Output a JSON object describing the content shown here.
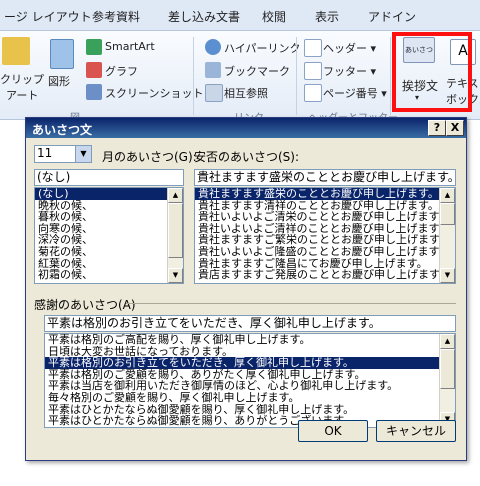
{
  "ribbon": {
    "tabs": [
      "ージ レイアウト",
      "参考資料",
      "差し込み文書",
      "校閲",
      "表示",
      "アドイン"
    ],
    "items": {
      "clip1": "クリップ",
      "clip2": "アート",
      "shape": "図形",
      "smartart": "SmartArt",
      "graph": "グラフ",
      "screenshot": "スクリーンショット ▾",
      "hyperlink": "ハイパーリンク",
      "bookmark": "ブックマーク",
      "crossref": "相互参照",
      "header": "ヘッダー ▾",
      "footer": "フッター ▾",
      "pagenum": "ページ番号 ▾",
      "greeting": "挨拶文",
      "greeting_icon_text": "あいさつ",
      "textbox1": "テキスト",
      "textbox2": "ボックス"
    },
    "groups": [
      "図",
      "リンク",
      "ヘッダーとフッター"
    ]
  },
  "dialog": {
    "title": "あいさつ文",
    "help": "?",
    "close": "X",
    "month_value": "11",
    "month_label": "月のあいさつ(G):",
    "anpi_label": "安否のあいさつ(S):",
    "month_field": "(なし)",
    "anpi_field": "貴社ますます盛栄のこととお慶び申し上げます。",
    "month_items": [
      "(なし)",
      "晩秋の候、",
      "暮秋の候、",
      "向寒の候、",
      "深冷の候、",
      "菊花の候、",
      "紅葉の候、",
      "初霜の候、"
    ],
    "month_selected": 0,
    "anpi_items": [
      "貴社ますます盛栄のこととお慶び申し上げます。",
      "貴社ますます清祥のこととお慶び申し上げます。",
      "貴社いよいよご清栄のこととお慶び申し上げます。",
      "貴社いよいよご清祥のこととお慶び申し上げます。",
      "貴社ますますご繁栄のこととお慶び申し上げます。",
      "貴社いよいよご隆盛のこととお慶び申し上げます。",
      "貴社ますますご隆昌にてお慶び申し上げます。",
      "貴店ますますご発展のこととお慶び申し上げます。"
    ],
    "anpi_selected": 0,
    "thanks_label": "感謝のあいさつ(A)",
    "thanks_field": "平素は格別のお引き立てをいただき、厚く御礼申し上げます。",
    "thanks_items": [
      "平素は格別のご高配を賜り、厚く御礼申し上げます。",
      "日頃は大変お世話になっております。",
      "平素は格別のお引き立てをいただき、厚く御礼申し上げます。",
      "平素は格別のご愛顧を賜り、ありがたく厚く御礼申し上げます。",
      "平素は当店を御利用いただき御厚情のほど、心より御礼申し上げます。",
      "毎々格別のご愛顧を賜り、厚く御礼申し上げます。",
      "平素はひとかたならぬ御愛顧を賜り、厚く御礼申し上げます。",
      "平素はひとかたならぬ御愛顧を賜り、ありがとうございます。"
    ],
    "thanks_selected": 2,
    "ok": "OK",
    "cancel": "キャンセル"
  },
  "colors": {
    "highlight": "#ff1010",
    "selection": "#0a246a",
    "titlebar": "#0a246a"
  }
}
